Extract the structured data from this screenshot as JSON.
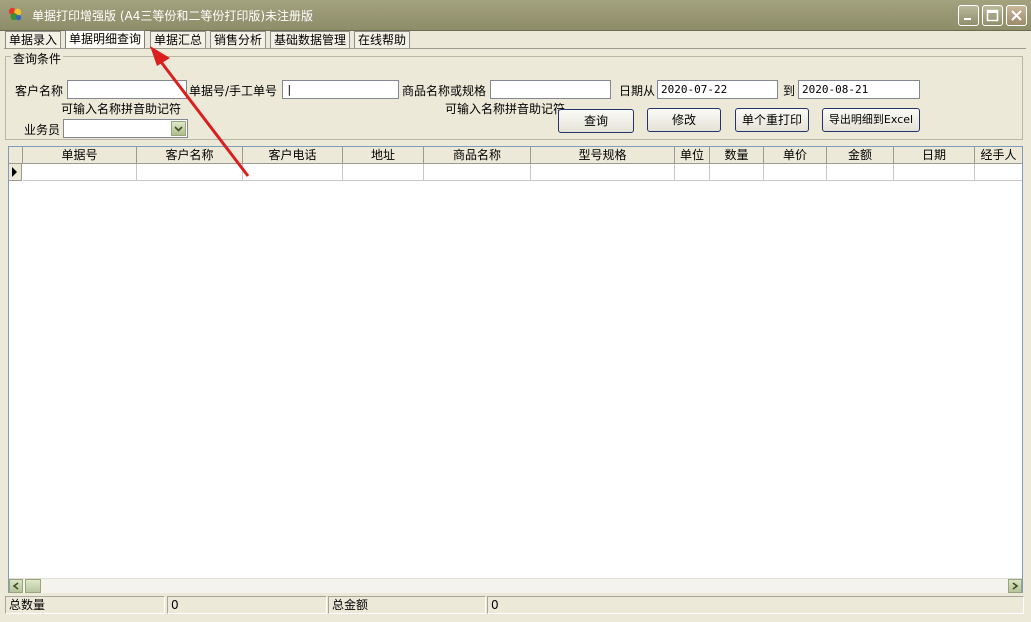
{
  "window": {
    "title": "单据打印增强版 (A4三等份和二等份打印版)未注册版"
  },
  "tabs": [
    {
      "label": "单据录入",
      "active": false
    },
    {
      "label": "单据明细查询",
      "active": true
    },
    {
      "label": "单据汇总",
      "active": false
    },
    {
      "label": "销售分析",
      "active": false
    },
    {
      "label": "基础数据管理",
      "active": false
    },
    {
      "label": "在线帮助",
      "active": false
    }
  ],
  "query": {
    "group_title": "查询条件",
    "customer_label": "客户名称",
    "customer_value": "",
    "customer_hint": "可输入名称拼音助记符",
    "bill_label": "单据号/手工单号",
    "bill_value": "|",
    "product_label": "商品名称或规格",
    "product_value": "",
    "product_hint": "可输入名称拼音助记符",
    "date_from_label": "日期从",
    "date_from_value": "2020-07-22",
    "date_to_label": "到",
    "date_to_value": "2020-08-21",
    "salesman_label": "业务员",
    "salesman_value": ""
  },
  "buttons": {
    "search": "查询",
    "edit": "修改",
    "reprint": "单个重打印",
    "export": "导出明细到Excel"
  },
  "grid": {
    "columns": [
      "单据号",
      "客户名称",
      "客户电话",
      "地址",
      "商品名称",
      "型号规格",
      "单位",
      "数量",
      "单价",
      "金额",
      "日期",
      "经手人"
    ]
  },
  "status": {
    "total_qty_label": "总数量",
    "total_qty_value": "0",
    "total_amount_label": "总金额",
    "total_amount_value": "0"
  },
  "colors": {
    "annotation_arrow": "#d9201e",
    "titlebar": "#9a9976"
  }
}
